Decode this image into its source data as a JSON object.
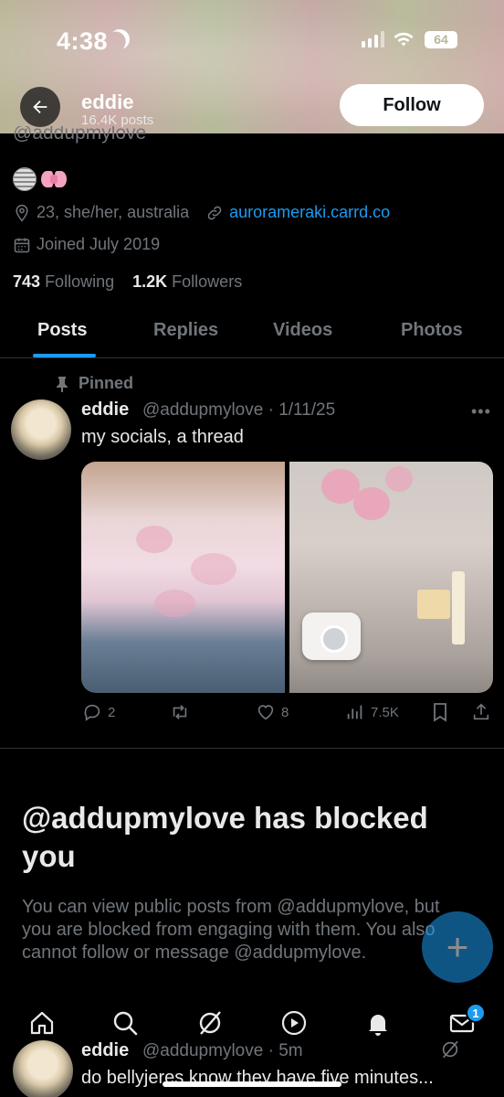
{
  "status_bar": {
    "time": "4:38",
    "battery": "64"
  },
  "header": {
    "name": "eddie",
    "posts_count": "16.4K posts",
    "follow_label": "Follow"
  },
  "profile": {
    "handle": "@addupmylove",
    "bio_location": "23, she/her, australia",
    "website": "aurorameraki.carrd.co",
    "joined": "Joined July 2019",
    "following_count": "743",
    "following_label": "Following",
    "followers_count": "1.2K",
    "followers_label": "Followers"
  },
  "tabs": [
    {
      "label": "Posts",
      "active": true
    },
    {
      "label": "Replies",
      "active": false
    },
    {
      "label": "Videos",
      "active": false
    },
    {
      "label": "Photos",
      "active": false
    }
  ],
  "pinned_tweet": {
    "pinned_label": "Pinned",
    "name": "eddie",
    "handle_date": "@addupmylove · 1/11/25",
    "text": "my socials, a thread",
    "replies": "2",
    "retweets": "",
    "likes": "8",
    "views": "7.5K"
  },
  "blocked": {
    "title": "@addupmylove has blocked you",
    "body": "You can view public posts from @addupmylove, but you are blocked from engaging with them. You also cannot follow or message @addupmylove."
  },
  "fab_label": "+",
  "messages_badge": "1",
  "next_tweet": {
    "name": "eddie",
    "handle_time": "@addupmylove · 5m",
    "text": "do bellyjeres know they have five minutes..."
  },
  "colors": {
    "accent": "#1d9bf0",
    "background": "#000000",
    "muted": "#71767b"
  }
}
